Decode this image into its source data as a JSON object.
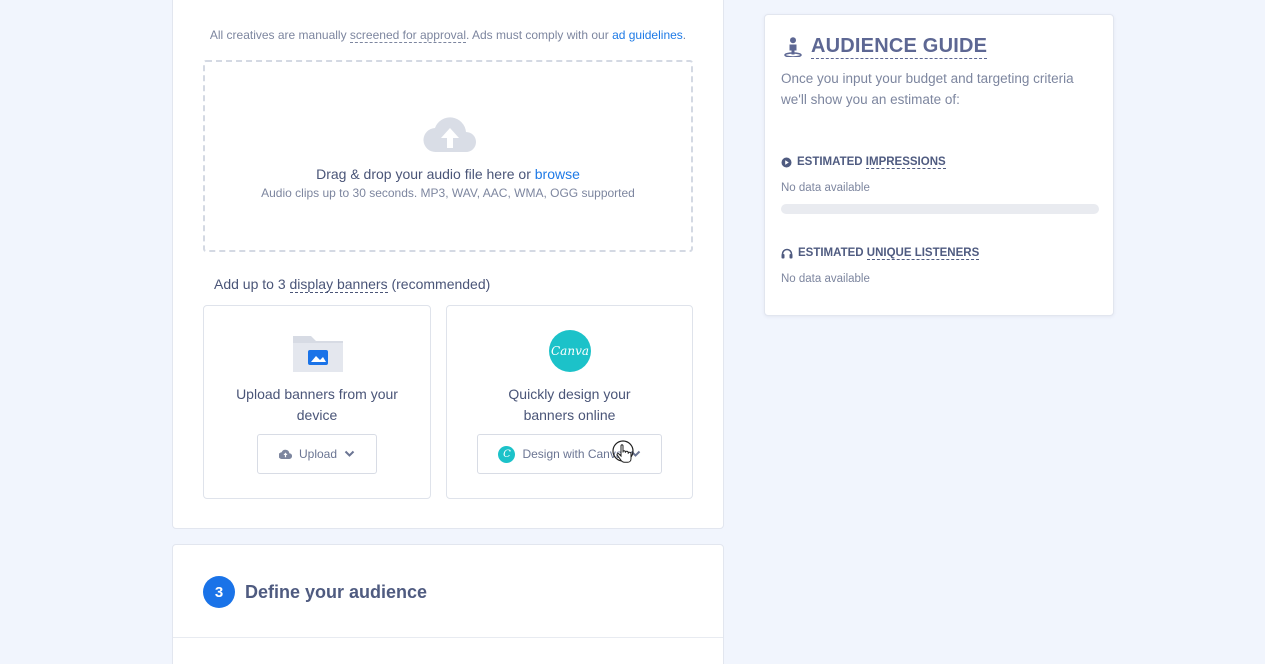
{
  "creative": {
    "approval_prefix": "All creatives are manually ",
    "approval_link": "screened for approval",
    "approval_middle": ". Ads must comply with our ",
    "guidelines_link": "ad guidelines",
    "approval_suffix": ".",
    "dropzone": {
      "main_text": "Drag & drop your audio file here or ",
      "browse_link": "browse",
      "sub_text": "Audio clips up to 30 seconds. MP3, WAV, AAC, WMA, OGG supported",
      "icon": "cloud-upload-icon"
    },
    "banners": {
      "prefix": "Add up to 3 ",
      "link": "display banners",
      "suffix": " (recommended)",
      "upload_card": {
        "text_line1": "Upload banners from your",
        "text_line2": "device",
        "button_label": "Upload",
        "icon": "folder-image-icon"
      },
      "canva_card": {
        "logo_text": "Canva",
        "text_line1": "Quickly design your",
        "text_line2": "banners online",
        "button_label": "Design with Canva",
        "button_logo": "C"
      }
    }
  },
  "audience_step": {
    "number": "3",
    "title": "Define your audience"
  },
  "guide": {
    "title": "AUDIENCE GUIDE",
    "description": "Once you input your budget and targeting criteria we'll show you an estimate of:",
    "impressions": {
      "prefix": "ESTIMATED ",
      "label": "IMPRESSIONS",
      "value": "No data available",
      "progress": 0
    },
    "listeners": {
      "prefix": "ESTIMATED ",
      "label": "UNIQUE LISTENERS",
      "value": "No data available"
    }
  },
  "colors": {
    "accent": "#1a73e8",
    "canva": "#1cc2c9",
    "background": "#f1f5fd"
  }
}
